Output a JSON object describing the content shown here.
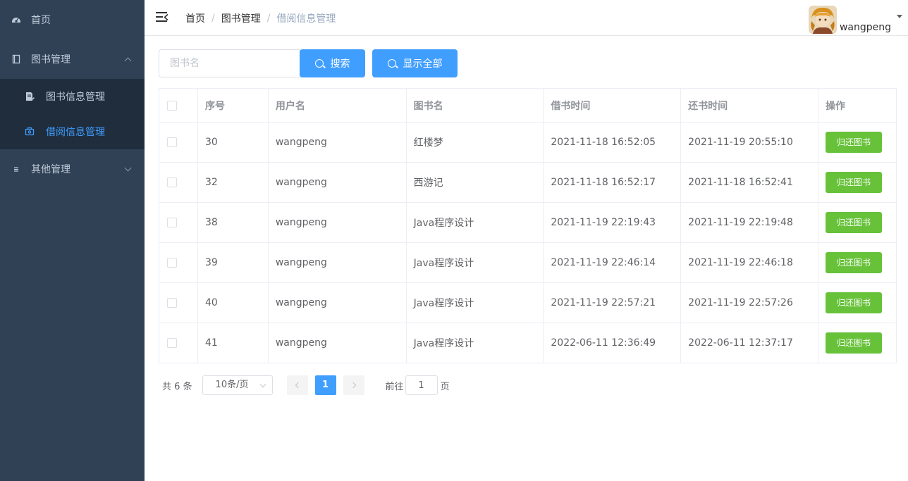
{
  "sidebar": {
    "items": [
      {
        "label": "首页",
        "icon": "dashboard-icon"
      },
      {
        "label": "图书管理",
        "icon": "book-icon",
        "expanded": true,
        "children": [
          {
            "label": "图书信息管理",
            "icon": "document-edit-icon"
          },
          {
            "label": "借阅信息管理",
            "icon": "borrow-icon",
            "active": true
          }
        ]
      },
      {
        "label": "其他管理",
        "icon": "list-icon",
        "expanded": false
      }
    ]
  },
  "header": {
    "breadcrumb": [
      "首页",
      "图书管理",
      "借阅信息管理"
    ],
    "username": "wangpeng"
  },
  "toolbar": {
    "search_placeholder": "图书名",
    "search_label": "搜索",
    "show_all_label": "显示全部"
  },
  "table": {
    "headers": [
      "序号",
      "用户名",
      "图书名",
      "借书时间",
      "还书时间",
      "操作"
    ],
    "rows": [
      {
        "id": "30",
        "user": "wangpeng",
        "book": "红楼梦",
        "borrow": "2021-11-18 16:52:05",
        "return": "2021-11-19 20:55:10",
        "action": "归还图书"
      },
      {
        "id": "32",
        "user": "wangpeng",
        "book": "西游记",
        "borrow": "2021-11-18 16:52:17",
        "return": "2021-11-18 16:52:41",
        "action": "归还图书"
      },
      {
        "id": "38",
        "user": "wangpeng",
        "book": "Java程序设计",
        "borrow": "2021-11-19 22:19:43",
        "return": "2021-11-19 22:19:48",
        "action": "归还图书"
      },
      {
        "id": "39",
        "user": "wangpeng",
        "book": "Java程序设计",
        "borrow": "2021-11-19 22:46:14",
        "return": "2021-11-19 22:46:18",
        "action": "归还图书"
      },
      {
        "id": "40",
        "user": "wangpeng",
        "book": "Java程序设计",
        "borrow": "2021-11-19 22:57:21",
        "return": "2021-11-19 22:57:26",
        "action": "归还图书"
      },
      {
        "id": "41",
        "user": "wangpeng",
        "book": "Java程序设计",
        "borrow": "2022-06-11 12:36:49",
        "return": "2022-06-11 12:37:17",
        "action": "归还图书"
      }
    ]
  },
  "pagination": {
    "total": "共 6 条",
    "page_size": "10条/页",
    "current_page": "1",
    "goto_prefix": "前往",
    "goto_value": "1",
    "goto_suffix": "页"
  },
  "colors": {
    "sidebar_bg": "#304156",
    "submenu_bg": "#1f2d3d",
    "primary": "#409eff",
    "success": "#67c23a"
  }
}
